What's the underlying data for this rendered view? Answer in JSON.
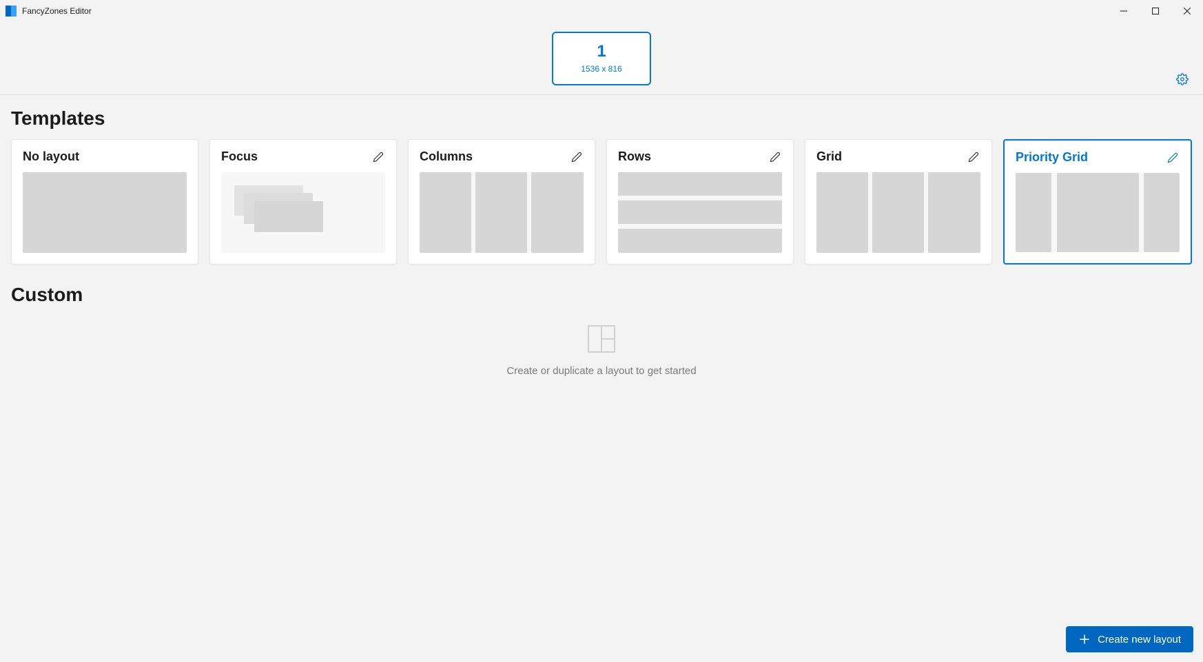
{
  "window": {
    "title": "FancyZones Editor"
  },
  "monitor": {
    "number": "1",
    "resolution": "1536 x 816"
  },
  "sections": {
    "templates": "Templates",
    "custom": "Custom"
  },
  "templates": {
    "no_layout": "No layout",
    "focus": "Focus",
    "columns": "Columns",
    "rows": "Rows",
    "grid": "Grid",
    "priority_grid": "Priority Grid"
  },
  "custom_empty_message": "Create or duplicate a layout to get started",
  "create_button_label": "Create new layout",
  "accent_color": "#0078d4"
}
